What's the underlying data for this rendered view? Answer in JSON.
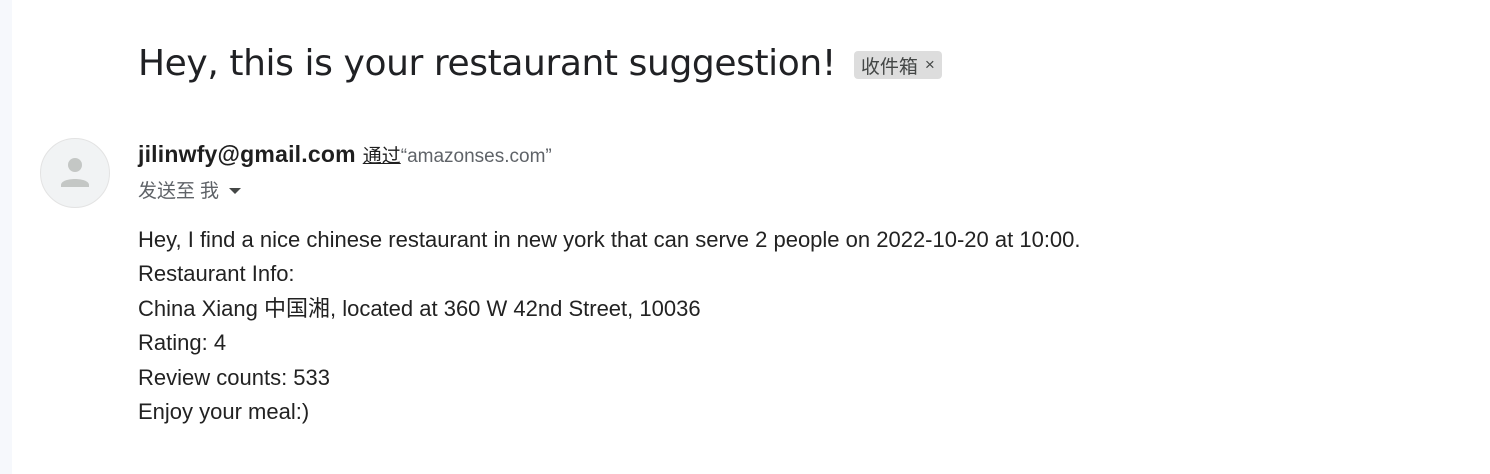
{
  "email": {
    "subject": "Hey, this is your restaurant suggestion!",
    "label": {
      "text": "收件箱",
      "close": "×"
    },
    "sender": {
      "address": "jilinwfy@gmail.com",
      "via_label": "通过",
      "via_domain": "“amazonses.com”",
      "avatar_icon": "person-icon"
    },
    "recipient": {
      "prefix": "发送至",
      "name": "我",
      "dropdown_icon": "caret-down-icon"
    },
    "body_lines": [
      "Hey, I find a nice chinese restaurant in new york that can serve 2 people on 2022-10-20 at 10:00.",
      "Restaurant Info:",
      "China Xiang 中国湘, located at 360 W 42nd Street, 10036",
      "Rating: 4",
      "Review counts: 533",
      "Enjoy your meal:)"
    ]
  },
  "colors": {
    "text": "#222222",
    "chip_bg": "#dddddd",
    "avatar_bg": "#f1f3f4",
    "avatar_glyph": "#c4c7c5"
  }
}
